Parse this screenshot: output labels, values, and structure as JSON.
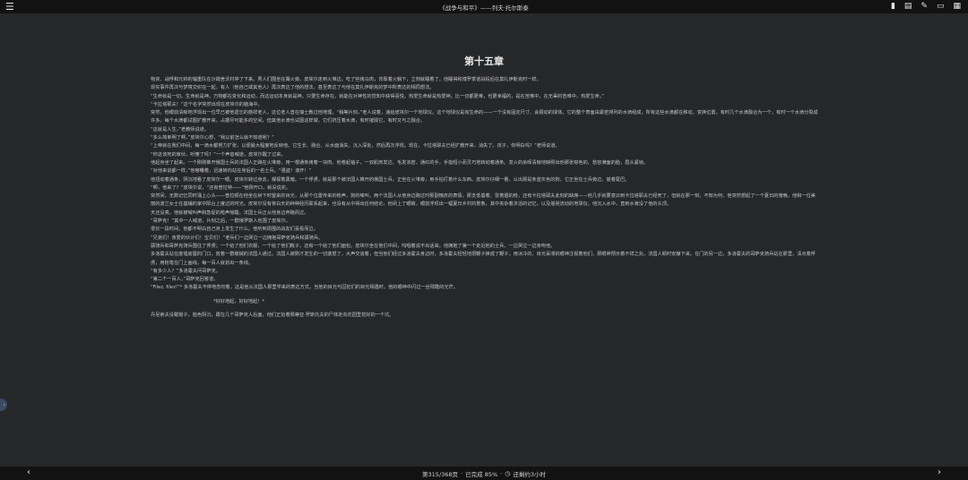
{
  "window": {
    "title": "《战争与和平》——列夫·托尔斯泰"
  },
  "toolbar": {
    "menu_icon": "☰",
    "icons": [
      "bookmark-icon",
      "book-icon",
      "pen-icon",
      "fullscreen-icon",
      "view-icon"
    ],
    "glyphs": [
      "▮",
      "▤",
      "✎",
      "▭",
      "▦"
    ]
  },
  "chapter": {
    "title": "第十五章"
  },
  "paragraphs": [
    "物资、战俘和元帅的辎重队在沙姆舍沃村停了下来。男人们围坐在篝火旁。皮埃尔走到火堆边，吃了些烤马肉，背靠着火躺下，立刻就睡着了。他睡得和博罗季诺战役后在莫扎伊斯克时一样。",
    "现实事件再次与梦境交织在一起，有人（他自己或其他人）再次表达了他的想法，甚至表达了与他在莫扎伊斯克的梦中所表达的相同想法。",
    "“生命就是一切。生命就是神。万物都在变化和运动，而这运动本身就是神。只要生命存在，就能在对神性的觉知中获得喜悦。热爱生命就是热爱神。比一切都更难，也更幸福的，是在苦难中，在无辜的苦难中，热爱生命。”",
    "“卡拉塔耶夫！”这个名字突然出现在皮埃尔的脑海中。",
    "突然，他眼前清晰地浮现出一位早已被他遗忘的慈祥老人，这位老人曾在瑞士教过他地理。“稍等片刻，”老人说着，递给皮埃尔一个地球仪。这个地球仪是有生命的——一个没有固定尺寸、会振动的球体。它的整个表面由紧密排列的水滴组成，所有这些水滴都在移动、变换位置，有时几个水滴融合为一个，有时一个水滴分裂成许多。每个水滴都试图扩散开来，占据尽可能多的空间，但其他水滴也试图这样做，它们挤压着水滴，有时摧毁它，有时又与之融合。",
    "“这就是人生，”老教师说道。",
    "“多么简单明了啊，”皮埃尔心想，“我以前怎么就不知道呢？”",
    "“上帝就在我们中间，每一滴水都努力扩张，以便最大程度地反映他。它生长、融合、从水面消失、沉入深处，然后再次浮现。现在，卡拉塔耶夫已经扩散开来，消失了。孩子，你明白吗？”老师说道。",
    "“你这该死的家伙，听懂了吗？”一个声音喊道，皮埃尔醒了过来。",
    "他起身坐了起来。一个刚刚推开俄国士兵的法国人正蹲在火堆旁，用一根通条烤着一块肉。他卷起袖子，一双肌肉发达、毛发浓密、通红的手，手指短小而灵巧地转动着通条。发火的余晖清晰地映照出他那张棕色的、愁容满面的脸，眉头紧锁。",
    "“对他来说都一样，”他嘟囔着，迅速转向站在身后的一名士兵。“强盗！滚开！”",
    "他扭动着通条，阴沉地看了皮埃尔一眼。皮埃尔转过身去，凝视着黑暗。一个俘虏，就是那个被法国人推开的俄国士兵，正坐在火堆旁，用手拍打着什么东西。皮埃尔仔细一看，认出那是条蓝灰色的狗，它正坐在士兵旁边，摇着尾巴。",
    "“啊，他来了？”皮埃尔说，“还有普拉特——”他刚开口，就没说完。",
    "突然间，无数记忆同时涌上心头——普拉顿在他坐在树下时望来的目光，从那个位置传来的枪声，狗的嚎叫，两个法国人从他身边跑过时那副愧疚的表情，那支低垂着、冒着烟的枪，还有卡拉塔耶夫此刻的缺席——他几乎就要意识到卡拉塔耶夫已经死了，但就在那一刻，不知为何，他突然想起了一个夏日的傍晚，他和一位美丽的波兰女士在基辅的家中阳台上度过的时光。皮埃尔没有将白天的种种经历联系起来，也没有从中得出任何结论，他闭上了眼睛，眼前浮现出一幅夏日乡村的景象，其中夹杂着沐浴的记忆，以及摇晃流动的地球仪，他沉入水中，直到水淹没了他的头顶。",
    "天还没亮，他就被喊叫声和急促的枪声惊醒。法国士兵正从他身边奔跑而过。",
    "“哥萨克！”其中一人喊道，片刻之后，一群俄罗斯人包围了皮埃尔。",
    "很长一段时间，他都不明白自己身上发生了什么。他听到周围的战友们喜极而泣。",
    "“兄弟们！亲爱的伙计们！宝贝们！”老兵们一边哭泣一边拥抱哥萨克骑兵和骠骑兵。",
    "骠骑兵和哥萨克骑兵围住了俘虏；一个给了他们衣服，一个给了他们靴子，还有一个给了他们面包。皮埃尔坐在他们中间，呜咽着说不出话来。他拥抱了第一个走近他的士兵，一边哭泣一边亲吻他。",
    "多洛霍夫站在废墟房屋的门口，放着一群缴械的法国人通过。法国人被刚才发生的一切激怒了，大声交谈着，但当他们经过多洛霍夫身边时，多洛霍夫轻轻地把鞭子换成了鞭子，用冰冷的、目光呆滞的眼神注视着他们，那眼神预示着不祥之兆，法国人顿时安静下来。在门的另一边，多洛霍夫的哥萨克骑兵站在那里，清点着俘虏，用粉笔在门上画线，每一百人就划出一条线。",
    "“有多少人？”多洛霍夫问哥萨克。",
    "“第二个一百人，”哥萨克回答道。",
    "“Filez, filez!”* 多洛霍夫不停地念叨着，这是他从法国人那里学来的表达方式，当他的目光与囚犯们的目光相遇时，他的眼神中闪过一丝残酷的光芒。",
    "*好好地起，好好地起！*",
    "丹尼索夫没戴帽子，脸色阴沉，跟在几个哥萨克人后面，他们正抬着佩蒂亚·罗斯托夫的尸体走向花园里挖好的一个坑。"
  ],
  "footer": {
    "prev": "‹",
    "next": "›",
    "page_label": "第315/368页",
    "separator": "·",
    "progress_label": "已完成 85%",
    "clock": "◷",
    "remaining_label": "还剩约3小时"
  },
  "side_handle": "›",
  "colors": {
    "background": "#262729",
    "bar": "#121212",
    "text": "#c4c4c4"
  }
}
